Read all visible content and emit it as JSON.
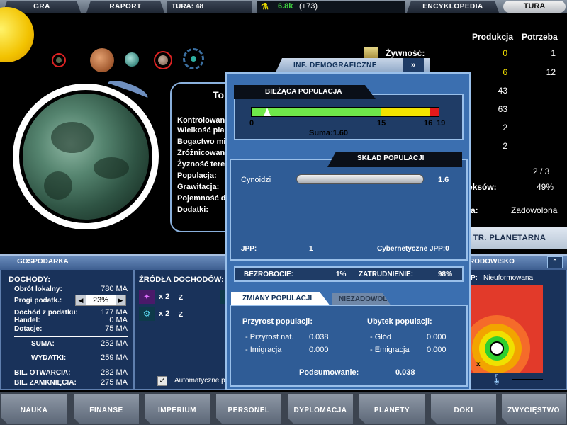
{
  "topbar": {
    "gra": "GRA",
    "raport": "RAPORT",
    "tura_label": "TURA: 48",
    "money": "6.8k",
    "money_delta": "(+73)",
    "encyklopedia": "ENCYKLOPEDIA",
    "tura_button": "TURA"
  },
  "planet_info": {
    "title": "To",
    "lines": [
      "Kontrolowan",
      "Wielkość pla",
      "Bogactwo mi",
      "Zróżnicowani",
      "Żyzność terer",
      "Populacja:",
      "Grawitacja:",
      "Pojemność d",
      "Dodatki:"
    ]
  },
  "right_stats": {
    "col_produkcja": "Produkcja",
    "col_potrzeba": "Potrzeba",
    "zywnosc_label": "Żywność:",
    "rows": [
      {
        "prod": "0",
        "need": "1",
        "color": "#f2e000"
      },
      {
        "prod": "6",
        "need": "12",
        "color": "#f2e000"
      },
      {
        "prod": "43",
        "need": "",
        "color": "#ffffff"
      },
      {
        "prod": "63",
        "need": "",
        "color": "#ffffff"
      },
      {
        "prod": "2",
        "need": "",
        "color": "#ffffff"
      },
      {
        "prod": "2",
        "need": "",
        "color": "#ffffff"
      }
    ],
    "ratio": "2 / 3",
    "eksow_label": "eksów:",
    "eksow_value": "49%",
    "mood_label": "a:",
    "mood_value": "Zadowolona",
    "str_planetarna": "TR. PLANETARNA"
  },
  "gospodarka": {
    "title": "GOSPODARKA",
    "dochody": "DOCHODY:",
    "obrot_label": "Obrót lokalny:",
    "obrot_value": "780 MA",
    "progi_label": "Progi podatk.:",
    "progi_value": "23%",
    "dochod_label": "Dochód z podatku:",
    "dochod_value": "177 MA",
    "handel_label": "Handel:",
    "handel_value": "0 MA",
    "dotacje_label": "Dotacje:",
    "dotacje_value": "75 MA",
    "suma_label": "SUMA:",
    "suma_value": "252 MA",
    "wydatki_label": "WYDATKI:",
    "wydatki_value": "259 MA",
    "bil_otw_label": "BIL. OTWARCIA:",
    "bil_otw_value": "282 MA",
    "bil_zam_label": "BIL. ZAMKNIĘCIA:",
    "bil_zam_value": "275 MA",
    "zrodla": "ŹRÓDŁA DOCHODÓW:",
    "src1_mult": "x 2",
    "src1_suffix": "Z",
    "src2_mult": "x 2",
    "src2_suffix": "Z",
    "auto_label": "Automatyczne pl"
  },
  "srodowisko": {
    "title": "RODOWISKO",
    "status_label": "P:",
    "status_value": "Nieuformowana",
    "marker": "x"
  },
  "modal": {
    "tab_title": "INF. DEMOGRAFICZNE",
    "biezaca": "BIEŻĄCA POPULACJA",
    "scale": [
      "0",
      "15",
      "16",
      "19"
    ],
    "suma": "Suma:1.60",
    "sklad": "SKŁAD POPULACJI",
    "race_name": "Cynoidzi",
    "race_value": "1.6",
    "jpp_label": "JPP:",
    "jpp_value": "1",
    "jpp_type": "Cybernetyczne JPP:0",
    "bezrobocie_label": "BEZROBOCIE:",
    "bezrobocie_value": "1%",
    "zatrudnienie_label": "ZATRUDNIENIE:",
    "zatrudnienie_value": "98%",
    "tab_zmiany": "ZMIANY POPULACJI",
    "tab_niezadowol": "NIEZADOWOL.",
    "przyrost_title": "Przyrost populacji:",
    "przyrost_nat_label": "- Przyrost nat.",
    "przyrost_nat_value": "0.038",
    "imigracja_label": "- Imigracja",
    "imigracja_value": "0.000",
    "ubytek_title": "Ubytek populacji:",
    "glod_label": "- Głód",
    "glod_value": "0.000",
    "emigracja_label": "- Emigracja",
    "emigracja_value": "0.000",
    "podsum_label": "Podsumowanie:",
    "podsum_value": "0.038",
    "population_level": 1.6,
    "population_max": 19
  },
  "bottomnav": [
    "NAUKA",
    "FINANSE",
    "IMPERIUM",
    "PERSONEL",
    "DYPLOMACJA",
    "PLANETY",
    "DOKI",
    "ZWYCIĘSTWO"
  ]
}
